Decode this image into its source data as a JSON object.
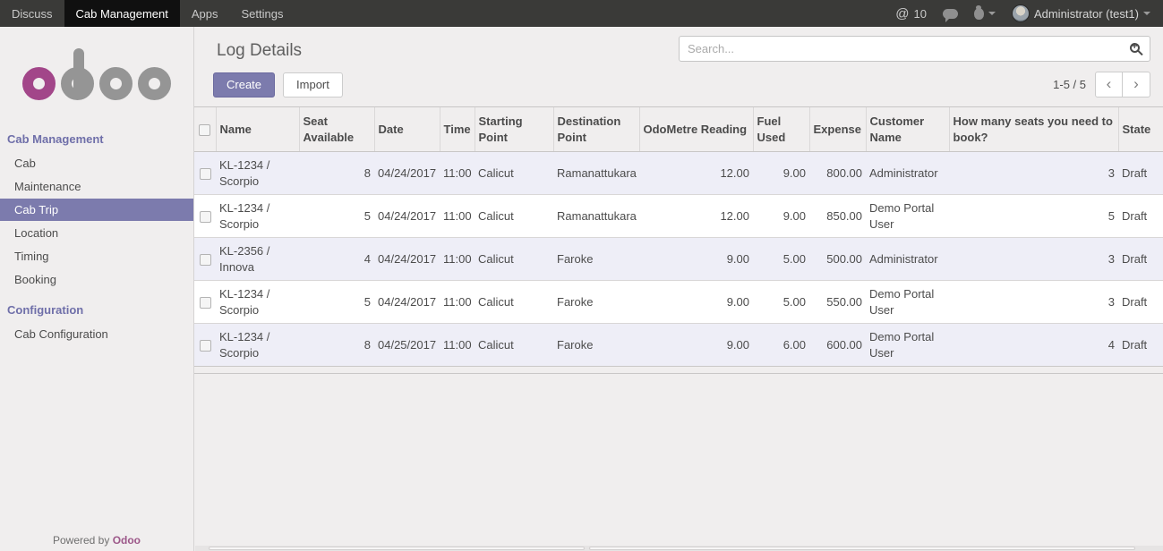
{
  "navbar": {
    "items": [
      {
        "label": "Discuss"
      },
      {
        "label": "Cab Management"
      },
      {
        "label": "Apps"
      },
      {
        "label": "Settings"
      }
    ],
    "mention_symbol": "@",
    "mention_count": "10",
    "user": "Administrator (test1)"
  },
  "sidebar": {
    "logo": "odoo",
    "sections": [
      {
        "heading": "Cab Management",
        "items": [
          "Cab",
          "Maintenance",
          "Cab Trip",
          "Location",
          "Timing",
          "Booking"
        ],
        "active_item": "Cab Trip"
      },
      {
        "heading": "Configuration",
        "items": [
          "Cab Configuration"
        ]
      }
    ],
    "footer_prefix": "Powered by",
    "footer_brand": "Odoo"
  },
  "main": {
    "title": "Log Details",
    "search_placeholder": "Search...",
    "create_label": "Create",
    "import_label": "Import",
    "pager_count": "1-5 / 5",
    "pager_prev": "‹",
    "pager_next": "›"
  },
  "table": {
    "columns": [
      "Name",
      "Seat Available",
      "Date",
      "Time",
      "Starting Point",
      "Destination Point",
      "OdoMetre Reading",
      "Fuel Used",
      "Expense",
      "Customer Name",
      "How many seats you need to book?",
      "State"
    ],
    "rows": [
      {
        "name": "KL-1234 / Scorpio",
        "seat_available": "8",
        "date": "04/24/2017",
        "time": "11:00",
        "starting_point": "Calicut",
        "destination_point": "Ramanattukara",
        "odometre_reading": "12.00",
        "fuel_used": "9.00",
        "expense": "800.00",
        "customer_name": "Administrator",
        "seats_needed": "3",
        "state": "Draft"
      },
      {
        "name": "KL-1234 / Scorpio",
        "seat_available": "5",
        "date": "04/24/2017",
        "time": "11:00",
        "starting_point": "Calicut",
        "destination_point": "Ramanattukara",
        "odometre_reading": "12.00",
        "fuel_used": "9.00",
        "expense": "850.00",
        "customer_name": "Demo Portal User",
        "seats_needed": "5",
        "state": "Draft"
      },
      {
        "name": "KL-2356 / Innova",
        "seat_available": "4",
        "date": "04/24/2017",
        "time": "11:00",
        "starting_point": "Calicut",
        "destination_point": "Faroke",
        "odometre_reading": "9.00",
        "fuel_used": "5.00",
        "expense": "500.00",
        "customer_name": "Administrator",
        "seats_needed": "3",
        "state": "Draft"
      },
      {
        "name": "KL-1234 / Scorpio",
        "seat_available": "5",
        "date": "04/24/2017",
        "time": "11:00",
        "starting_point": "Calicut",
        "destination_point": "Faroke",
        "odometre_reading": "9.00",
        "fuel_used": "5.00",
        "expense": "550.00",
        "customer_name": "Demo Portal User",
        "seats_needed": "3",
        "state": "Draft"
      },
      {
        "name": "KL-1234 / Scorpio",
        "seat_available": "8",
        "date": "04/25/2017",
        "time": "11:00",
        "starting_point": "Calicut",
        "destination_point": "Faroke",
        "odometre_reading": "9.00",
        "fuel_used": "6.00",
        "expense": "600.00",
        "customer_name": "Demo Portal User",
        "seats_needed": "4",
        "state": "Draft"
      }
    ]
  },
  "colors": {
    "accent_purple": "#7c7bad",
    "brand_magenta": "#a24689",
    "navbar_bg": "#3a3a38",
    "navbar_active_bg": "#101010",
    "page_bg": "#f0eeee",
    "row_alt_bg": "#eeeef7",
    "sidebar_heading": "#6f6fa9"
  }
}
